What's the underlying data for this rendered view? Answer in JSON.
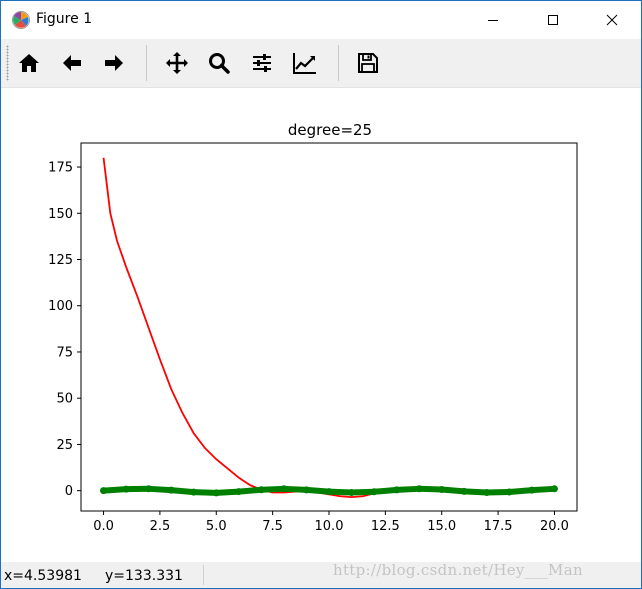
{
  "window": {
    "title": "Figure 1",
    "controls": {
      "minimize": "minimize",
      "maximize": "maximize",
      "close": "close"
    }
  },
  "toolbar": {
    "buttons": [
      {
        "icon": "home-icon",
        "label": "Home"
      },
      {
        "icon": "back-arrow-icon",
        "label": "Back"
      },
      {
        "icon": "forward-arrow-icon",
        "label": "Forward"
      },
      {
        "icon": "move-icon",
        "label": "Pan"
      },
      {
        "icon": "zoom-icon",
        "label": "Zoom"
      },
      {
        "icon": "sliders-icon",
        "label": "Subplots"
      },
      {
        "icon": "line-chart-icon",
        "label": "Customize"
      },
      {
        "icon": "save-icon",
        "label": "Save"
      }
    ]
  },
  "chart_data": {
    "type": "line",
    "title": "degree=25",
    "xlabel": "",
    "ylabel": "",
    "xlim": [
      -1,
      21
    ],
    "ylim": [
      -11,
      188
    ],
    "xticks": [
      "0.0",
      "2.5",
      "5.0",
      "7.5",
      "10.0",
      "12.5",
      "15.0",
      "17.5",
      "20.0"
    ],
    "yticks": [
      "0",
      "25",
      "50",
      "75",
      "100",
      "125",
      "150",
      "175"
    ],
    "grid": false,
    "series": [
      {
        "color": "#ff0000",
        "style": "line",
        "x": [
          0,
          0.3,
          0.6,
          1,
          1.5,
          2,
          2.5,
          3,
          3.5,
          4,
          4.5,
          5,
          5.5,
          6,
          6.5,
          7,
          7.5,
          8,
          8.5,
          9,
          9.5,
          10,
          10.5,
          11,
          11.5,
          12
        ],
        "y": [
          180,
          150,
          135,
          121,
          105,
          88,
          71,
          55,
          42,
          31,
          23,
          17,
          12,
          7,
          3,
          0.5,
          -1,
          -1,
          -0.5,
          0,
          -1,
          -2,
          -3,
          -3.5,
          -3,
          -1.5
        ]
      },
      {
        "color": "#008000",
        "style": "markers",
        "x": [
          0,
          1,
          2,
          3,
          4,
          5,
          6,
          7,
          8,
          9,
          10,
          11,
          12,
          13,
          14,
          15,
          16,
          17,
          18,
          19,
          20
        ],
        "y": [
          0,
          0.8,
          1,
          0.3,
          -0.8,
          -1.2,
          -0.5,
          0.5,
          1,
          0.4,
          -0.5,
          -1,
          -0.6,
          0.4,
          1,
          0.6,
          -0.4,
          -1,
          -0.7,
          0.3,
          1
        ]
      }
    ]
  },
  "status": {
    "x": "x=4.53981",
    "y": "y=133.331"
  },
  "watermark": "http://blog.csdn.net/Hey___Man"
}
